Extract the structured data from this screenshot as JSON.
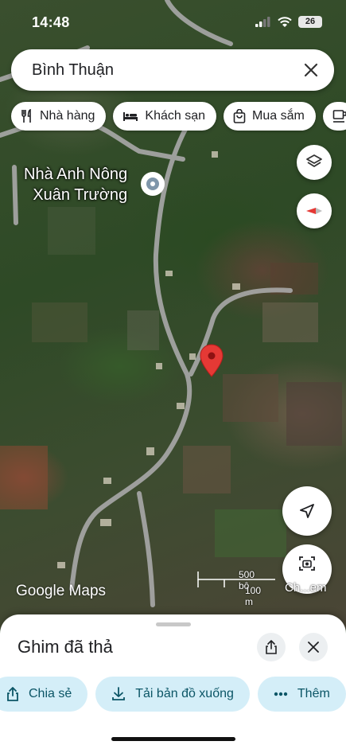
{
  "status_bar": {
    "time": "14:48",
    "battery": "26"
  },
  "search": {
    "query": "Bình Thuận"
  },
  "chips": [
    {
      "label": "Nhà hàng",
      "icon": "restaurant-icon"
    },
    {
      "label": "Khách sạn",
      "icon": "bed-icon"
    },
    {
      "label": "Mua sắm",
      "icon": "shopping-bag-icon"
    }
  ],
  "map": {
    "place_name_line1": "Nhà Anh Nông",
    "place_name_line2": "Xuân Trường",
    "logo": "Google Maps",
    "scale_imperial": "500 bộ",
    "scale_metric": "100 m",
    "streetview_label": "Ch...em"
  },
  "sheet": {
    "title": "Ghim đã thả",
    "actions": [
      {
        "label": "Chia sẻ",
        "icon": "share-icon"
      },
      {
        "label": "Tải bản đồ xuống",
        "icon": "download-icon"
      },
      {
        "label": "Thêm",
        "icon": "more-dots-icon"
      }
    ]
  },
  "colors": {
    "pin": "#e53935",
    "action_bg": "#d4eef8",
    "action_text": "#0b5566"
  }
}
